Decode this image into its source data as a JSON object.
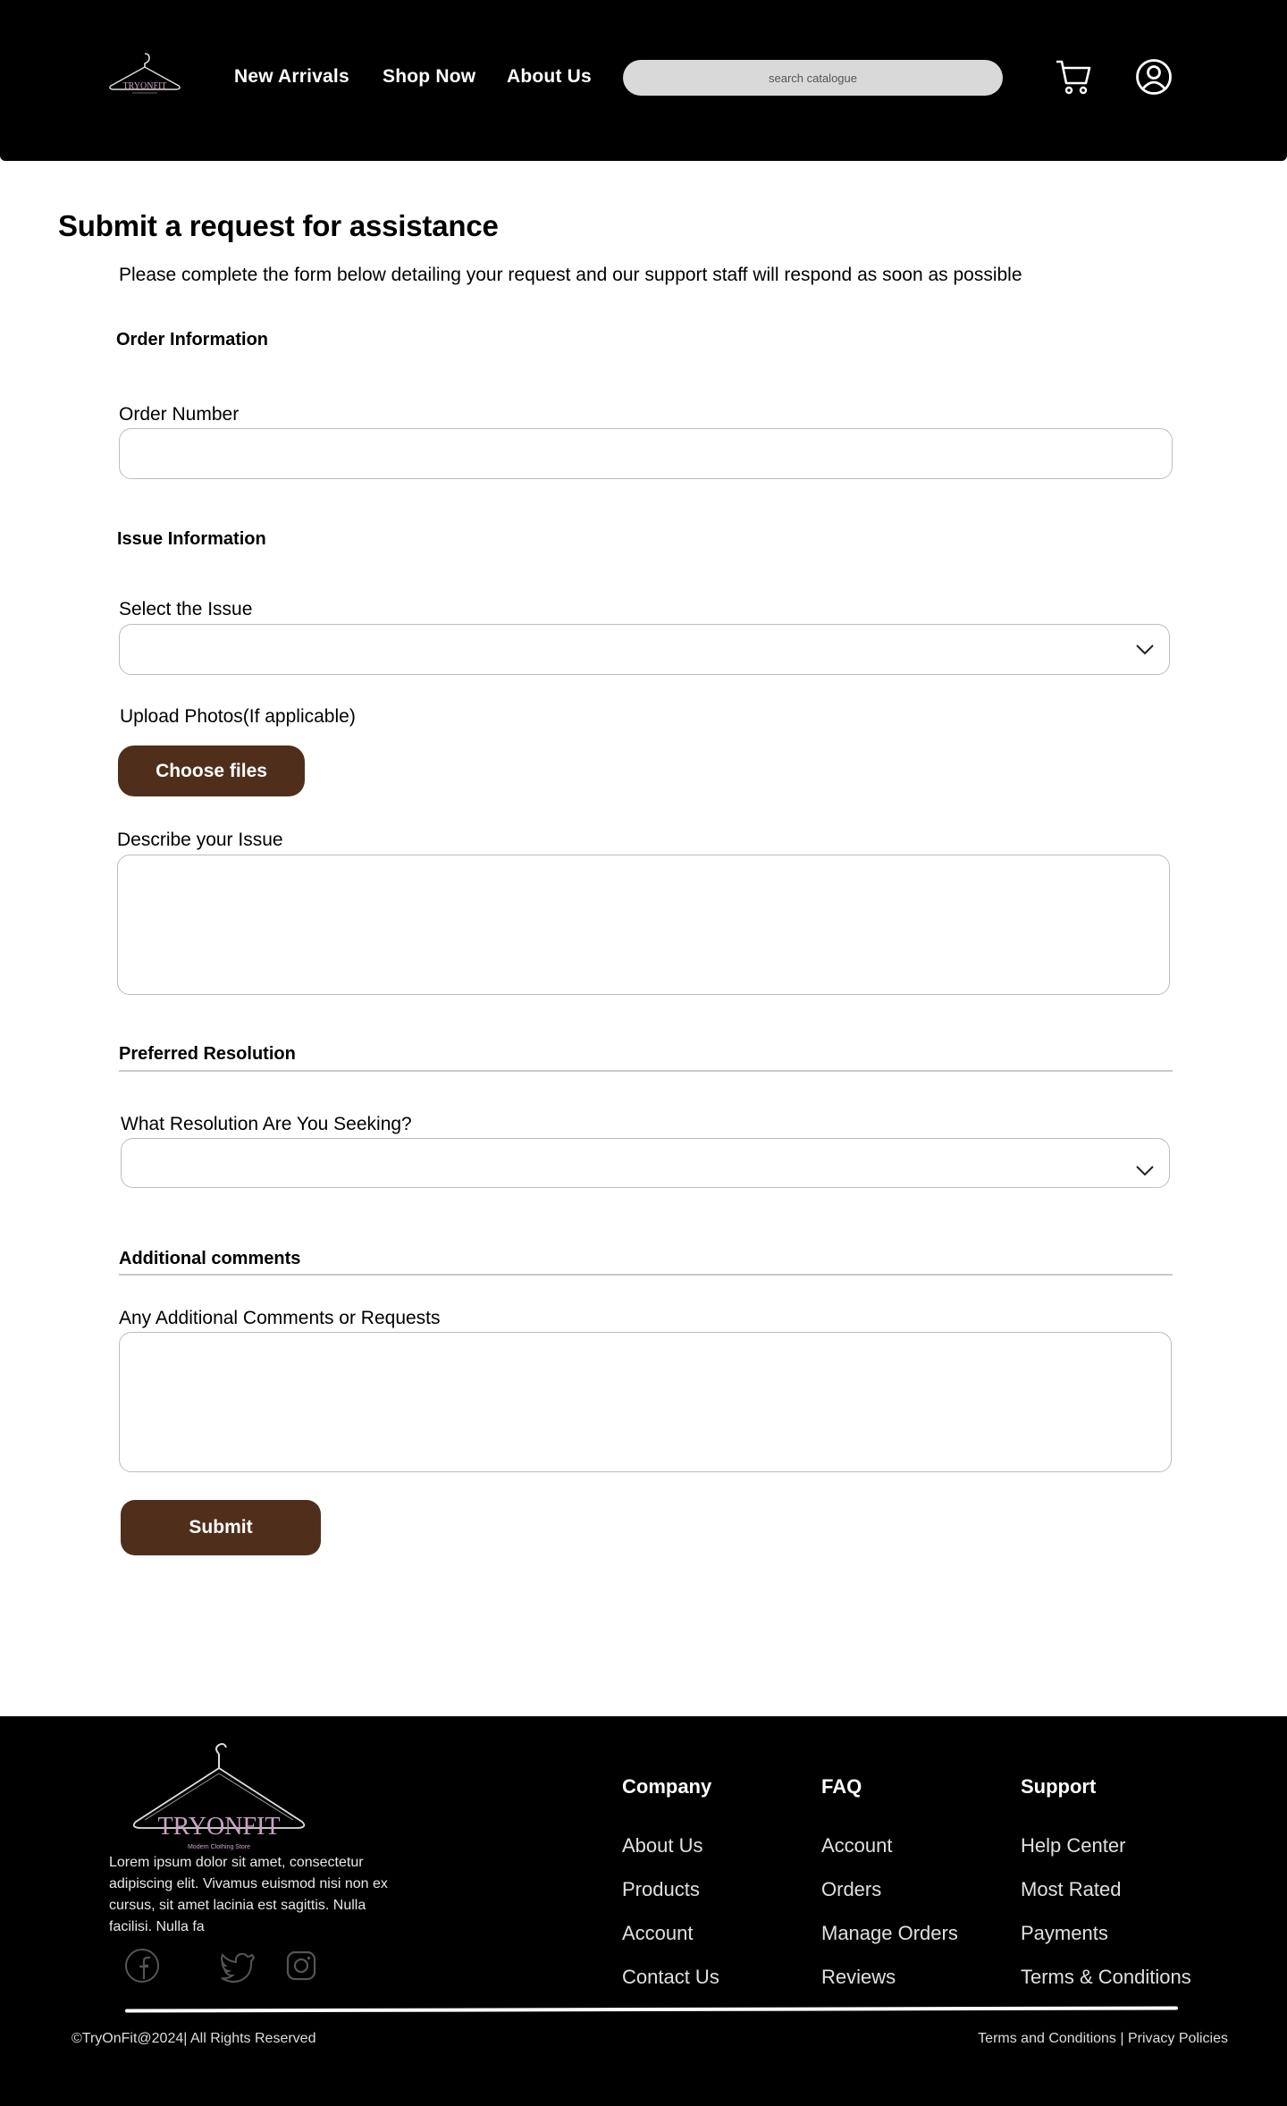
{
  "header": {
    "logo_text": "TRYONFIT",
    "nav": [
      {
        "label": "New Arrivals"
      },
      {
        "label": "Shop Now"
      },
      {
        "label": "About Us"
      }
    ],
    "search": {
      "placeholder": "search catalogue"
    },
    "icons": [
      "logo-hanger-icon",
      "cart-icon",
      "user-account-icon"
    ]
  },
  "main": {
    "title": "Submit a request for assistance",
    "intro": "Please complete the form below detailing your request and our support staff will respond as soon as possible",
    "order_section": {
      "title": "Order Information",
      "order_number_label": "Order Number",
      "order_number_value": ""
    },
    "issue_section": {
      "title": "Issue Information",
      "select_label": "Select the Issue",
      "select_value": "",
      "upload_label": "Upload Photos(If applicable)",
      "upload_button": "Choose files",
      "describe_label": "Describe your Issue",
      "describe_value": ""
    },
    "resolution_section": {
      "title": "Preferred Resolution",
      "select_label": "What Resolution Are You Seeking?",
      "select_value": ""
    },
    "comments_section": {
      "title": "Additional comments",
      "comments_label": "Any Additional Comments or Requests",
      "comments_value": ""
    },
    "submit_label": "Submit"
  },
  "footer": {
    "logo_text": "TRYONFIT",
    "logo_tagline": "Modern Clothing Store",
    "description": "Lorem ipsum dolor sit amet, consectetur adipiscing elit. Vivamus euismod nisi non ex cursus, sit amet lacinia est sagittis. Nulla facilisi. Nulla fa",
    "social_icons": [
      "facebook-icon",
      "twitter-icon",
      "instagram-icon"
    ],
    "columns": [
      {
        "heading": "Company",
        "items": [
          "About Us",
          "Products",
          "Account",
          "Contact Us"
        ]
      },
      {
        "heading": "FAQ",
        "items": [
          "Account",
          "Orders",
          "Manage Orders",
          "Reviews"
        ]
      },
      {
        "heading": "Support",
        "items": [
          "Help Center",
          "Most Rated",
          "Payments",
          "Terms & Conditions"
        ]
      }
    ],
    "copyright": "©TryOnFit@2024| All Rights Reserved",
    "legal": "Terms and Conditions | Privacy Policies"
  },
  "colors": {
    "header_bg": "#000000",
    "footer_bg": "#000000",
    "button_brown": "#4f2f1b",
    "search_bg": "#d9d9d9"
  }
}
